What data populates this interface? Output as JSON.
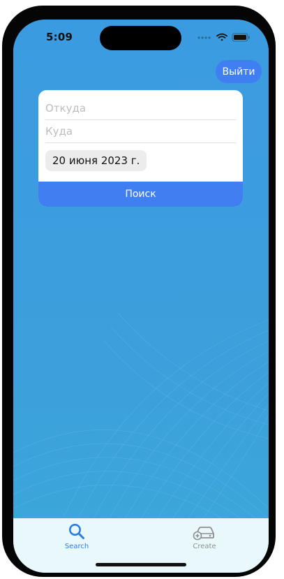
{
  "status_bar": {
    "time": "5:09",
    "icons": [
      "signal-dots-icon",
      "wifi-icon",
      "battery-icon"
    ]
  },
  "header": {
    "logout_label": "Выйти"
  },
  "search_form": {
    "from_placeholder": "Откуда",
    "from_value": "",
    "to_placeholder": "Куда",
    "to_value": "",
    "date_label": "20 июня 2023 г.",
    "search_label": "Поиск"
  },
  "tab_bar": {
    "tabs": [
      {
        "label": "Search",
        "icon": "magnifier-icon",
        "selected": true
      },
      {
        "label": "Create",
        "icon": "car-add-icon",
        "selected": false
      }
    ]
  },
  "colors": {
    "background": "#3d9ddf",
    "accent": "#3f7ff2",
    "tab_bar_background": "#e9f9fb",
    "tab_selected": "#2a7be8",
    "tab_unselected": "#8e8e93"
  }
}
